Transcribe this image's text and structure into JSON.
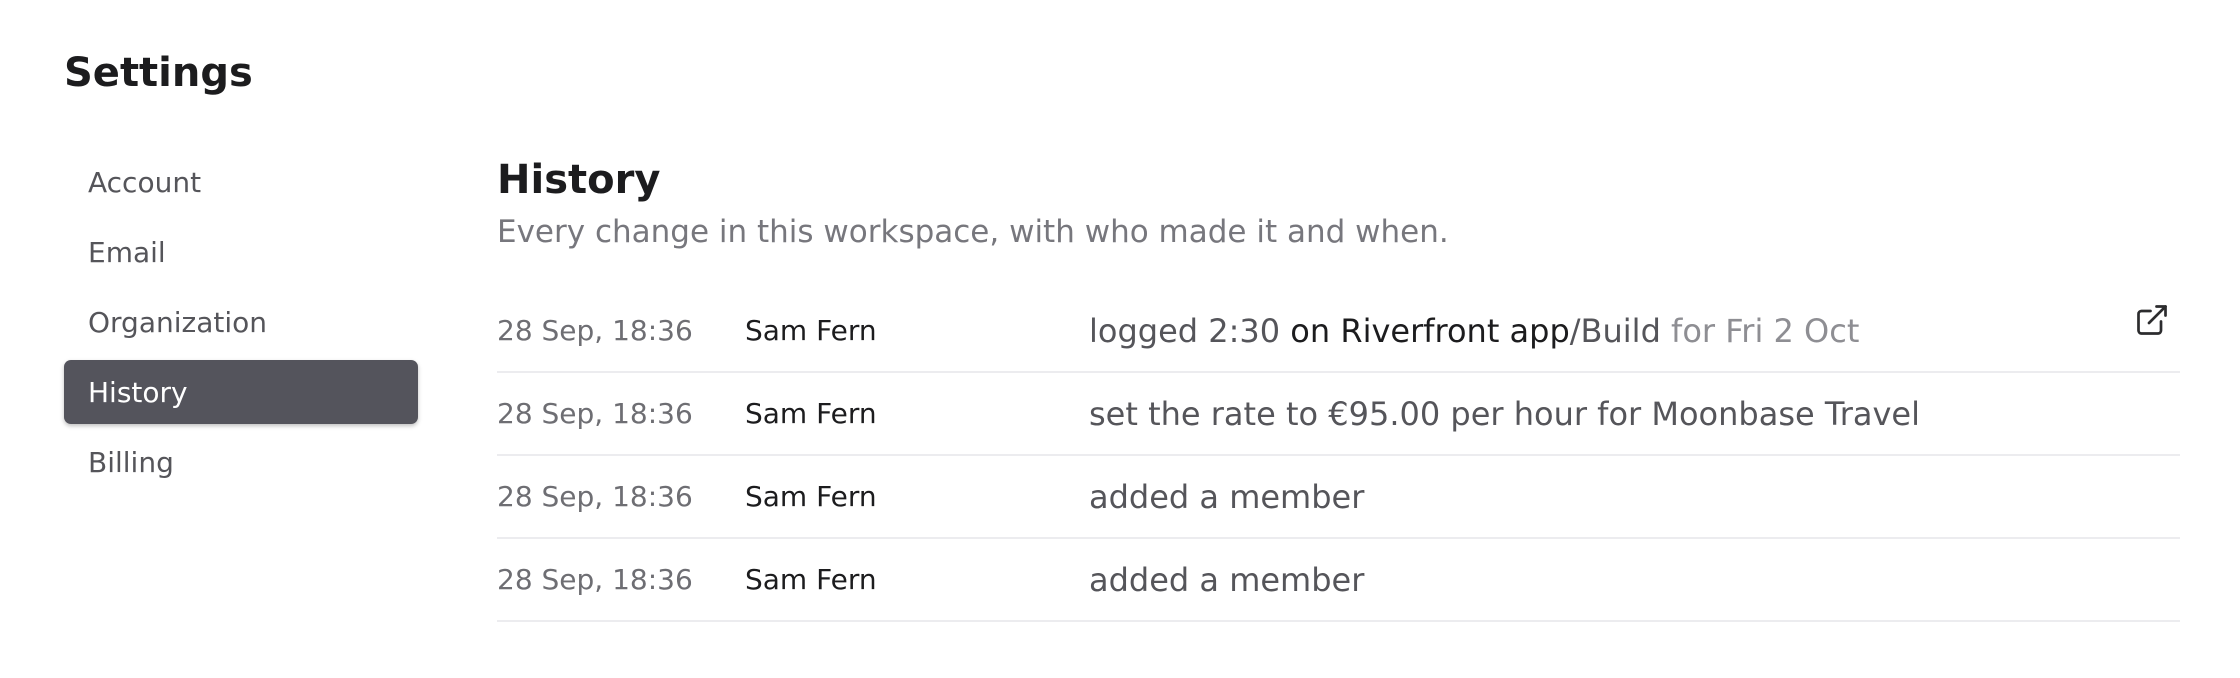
{
  "page": {
    "title": "Settings"
  },
  "sidebar": {
    "items": [
      {
        "label": "Account"
      },
      {
        "label": "Email"
      },
      {
        "label": "Organization"
      },
      {
        "label": "History"
      },
      {
        "label": "Billing"
      }
    ],
    "active_label": "History"
  },
  "main": {
    "title": "History",
    "subtitle": "Every change in this workspace, with who made it and when.",
    "rows": [
      {
        "time": "28 Sep, 18:36",
        "user": "Sam Fern",
        "action": "logged 2:30",
        "connector": " on ",
        "project": "Riverfront app",
        "separator": "/",
        "task": "Build",
        "date_text": " for Fri 2 Oct",
        "open_icon": "external-link-icon"
      },
      {
        "time": "28 Sep, 18:36",
        "user": "Sam Fern",
        "description": "set the rate to €95.00 per hour for Moonbase Travel"
      },
      {
        "time": "28 Sep, 18:36",
        "user": "Sam Fern",
        "description": "added a member"
      },
      {
        "time": "28 Sep, 18:36",
        "user": "Sam Fern",
        "description": "added a member"
      }
    ]
  },
  "colors": {
    "active_item_bg": "#54545c",
    "row_divider": "#ececef",
    "muted_text": "#77777d"
  }
}
